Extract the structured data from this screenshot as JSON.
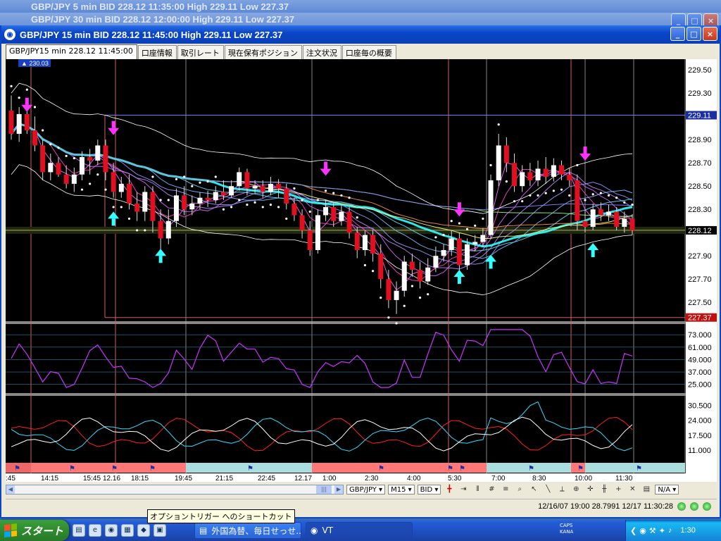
{
  "bg_windows": [
    {
      "title": "GBP/JPY 5 min BID 228.12 11:35:00 High 229.11 Low 227.37"
    },
    {
      "title": "GBP/JPY 30 min BID 228.12 12:00:00 High 229.11 Low 227.37"
    }
  ],
  "window": {
    "title": "GBP/JPY 15 min BID 228.12 11:45:00 High 229.11 Low 227.37",
    "min": "_",
    "max": "□",
    "close": "×"
  },
  "tabs": [
    {
      "label": "GBP/JPY15 min 228.12 11:45:00"
    },
    {
      "label": "口座情報"
    },
    {
      "label": "取引レート"
    },
    {
      "label": "現在保有ポジション"
    },
    {
      "label": "注文状況"
    },
    {
      "label": "口座毎の概要"
    }
  ],
  "chart_data": {
    "type": "candlestick",
    "symbol": "GBP/JPY",
    "timeframe": "15 min",
    "marker_label": "230.03",
    "price_ticks": [
      "229.50",
      "229.30",
      "229.11",
      "228.90",
      "228.70",
      "228.50",
      "228.30",
      "228.12",
      "227.90",
      "227.70",
      "227.50",
      "227.37"
    ],
    "price_ylim": [
      227.35,
      229.58
    ],
    "current_price": "228.12",
    "high_label": "229.11",
    "low_label": "227.37",
    "osc1_ticks": [
      "73.000",
      "61.000",
      "49.000",
      "37.000",
      "25.000"
    ],
    "osc1_ylim": [
      18,
      82
    ],
    "osc2_ticks": [
      "30.500",
      "24.000",
      "17.500",
      "11.000"
    ],
    "osc2_ylim": [
      7,
      34
    ],
    "time_labels": [
      ":45",
      "14:15",
      "15:45",
      "12.16",
      "18:15",
      "19:45",
      "21:15",
      "22:45",
      "12.17",
      "1:00",
      "2:30",
      "4:00",
      "5:30",
      "7:00",
      "8:30",
      "10:00",
      "11:30"
    ],
    "candles": [
      [
        229.15,
        228.95,
        229.28,
        228.9
      ],
      [
        228.95,
        229.12,
        229.18,
        228.88
      ],
      [
        229.12,
        228.98,
        229.25,
        228.95
      ],
      [
        228.98,
        228.85,
        229.1,
        228.8
      ],
      [
        228.85,
        228.62,
        228.9,
        228.55
      ],
      [
        228.62,
        228.7,
        228.78,
        228.55
      ],
      [
        228.7,
        228.6,
        228.75,
        228.58
      ],
      [
        228.6,
        228.52,
        228.68,
        228.48
      ],
      [
        228.52,
        228.6,
        228.66,
        228.45
      ],
      [
        228.6,
        228.75,
        228.8,
        228.55
      ],
      [
        228.75,
        228.72,
        228.82,
        228.6
      ],
      [
        228.72,
        228.85,
        228.9,
        228.68
      ],
      [
        228.85,
        228.62,
        228.9,
        228.55
      ],
      [
        228.62,
        228.45,
        228.7,
        228.4
      ],
      [
        228.45,
        228.52,
        228.58,
        228.4
      ],
      [
        228.52,
        228.35,
        228.6,
        228.3
      ],
      [
        228.35,
        228.28,
        228.45,
        228.2
      ],
      [
        228.28,
        228.45,
        228.5,
        228.2
      ],
      [
        228.45,
        228.2,
        228.5,
        228.1
      ],
      [
        228.2,
        228.05,
        228.3,
        227.95
      ],
      [
        228.05,
        228.2,
        228.3,
        228.0
      ],
      [
        228.2,
        228.42,
        228.48,
        228.15
      ],
      [
        228.42,
        228.3,
        228.5,
        228.25
      ],
      [
        228.3,
        228.35,
        228.42,
        228.25
      ],
      [
        228.35,
        228.4,
        228.45,
        228.3
      ],
      [
        228.4,
        228.38,
        228.46,
        228.32
      ],
      [
        228.38,
        228.45,
        228.5,
        228.35
      ],
      [
        228.45,
        228.42,
        228.55,
        228.38
      ],
      [
        228.42,
        228.5,
        228.55,
        228.4
      ],
      [
        228.5,
        228.62,
        228.66,
        228.46
      ],
      [
        228.62,
        228.48,
        228.65,
        228.42
      ],
      [
        228.48,
        228.5,
        228.55,
        228.44
      ],
      [
        228.5,
        228.45,
        228.55,
        228.4
      ],
      [
        228.45,
        228.52,
        228.58,
        228.42
      ],
      [
        228.52,
        228.48,
        228.56,
        228.4
      ],
      [
        228.48,
        228.35,
        228.52,
        228.3
      ],
      [
        228.35,
        228.25,
        228.4,
        228.2
      ],
      [
        228.25,
        228.12,
        228.3,
        228.05
      ],
      [
        228.12,
        227.95,
        228.2,
        227.9
      ],
      [
        227.95,
        228.25,
        228.3,
        227.92
      ],
      [
        228.25,
        228.32,
        228.38,
        228.2
      ],
      [
        228.32,
        228.2,
        228.36,
        228.15
      ],
      [
        228.2,
        228.28,
        228.34,
        228.16
      ],
      [
        228.28,
        228.1,
        228.32,
        228.05
      ],
      [
        228.1,
        227.95,
        228.15,
        227.88
      ],
      [
        227.95,
        228.08,
        228.12,
        227.9
      ],
      [
        228.08,
        227.92,
        228.12,
        227.85
      ],
      [
        227.92,
        227.7,
        228.0,
        227.62
      ],
      [
        227.7,
        227.52,
        227.78,
        227.45
      ],
      [
        227.52,
        227.6,
        227.68,
        227.4
      ],
      [
        227.6,
        227.85,
        227.9,
        227.55
      ],
      [
        227.85,
        227.78,
        227.92,
        227.72
      ],
      [
        227.78,
        227.68,
        227.85,
        227.62
      ],
      [
        227.68,
        227.8,
        227.88,
        227.65
      ],
      [
        227.8,
        227.9,
        227.98,
        227.76
      ],
      [
        227.9,
        227.95,
        228.0,
        227.85
      ],
      [
        227.95,
        228.05,
        228.12,
        227.9
      ],
      [
        228.05,
        227.82,
        228.1,
        227.75
      ],
      [
        227.82,
        228.0,
        228.05,
        227.78
      ],
      [
        228.0,
        228.02,
        228.08,
        227.94
      ],
      [
        228.02,
        228.08,
        228.14,
        227.98
      ],
      [
        228.08,
        228.55,
        228.6,
        228.05
      ],
      [
        228.55,
        228.85,
        228.95,
        228.5
      ],
      [
        228.85,
        228.7,
        228.92,
        228.62
      ],
      [
        228.7,
        228.5,
        228.78,
        228.45
      ],
      [
        228.5,
        228.62,
        228.68,
        228.45
      ],
      [
        228.62,
        228.55,
        228.7,
        228.5
      ],
      [
        228.55,
        228.65,
        228.72,
        228.5
      ],
      [
        228.65,
        228.58,
        228.75,
        228.52
      ],
      [
        228.58,
        228.68,
        228.74,
        228.54
      ],
      [
        228.68,
        228.6,
        228.72,
        228.55
      ],
      [
        228.6,
        228.55,
        228.66,
        228.5
      ],
      [
        228.55,
        228.2,
        228.6,
        228.12
      ],
      [
        228.2,
        228.15,
        228.3,
        228.1
      ],
      [
        228.15,
        228.3,
        228.35,
        228.12
      ],
      [
        228.3,
        228.25,
        228.36,
        228.2
      ],
      [
        228.25,
        228.28,
        228.34,
        228.2
      ],
      [
        228.28,
        228.15,
        228.32,
        228.12
      ],
      [
        228.15,
        228.22,
        228.28,
        228.1
      ],
      [
        228.22,
        228.12,
        228.26,
        228.08
      ]
    ]
  },
  "toolbar": {
    "symbol": "GBP/JPY ▾",
    "tf": "M15 ▾",
    "side": "BID ▾",
    "na": "N/A ▾"
  },
  "status": {
    "text": "12/16/07 19:00   28.7991  12/17 11:30:28"
  },
  "tooltip": {
    "text": "オプショントリガー へのショートカット"
  },
  "taskbar": {
    "start": "スタート",
    "tasks": [
      {
        "label": "外国為替、毎日せっせ..."
      },
      {
        "label": "VT"
      }
    ],
    "caps": "CAPS",
    "kana": "KANA",
    "clock": "1:30"
  },
  "colors": {
    "accent": "#0a46c8",
    "bull": "#ffffff",
    "bear": "#e01020"
  }
}
